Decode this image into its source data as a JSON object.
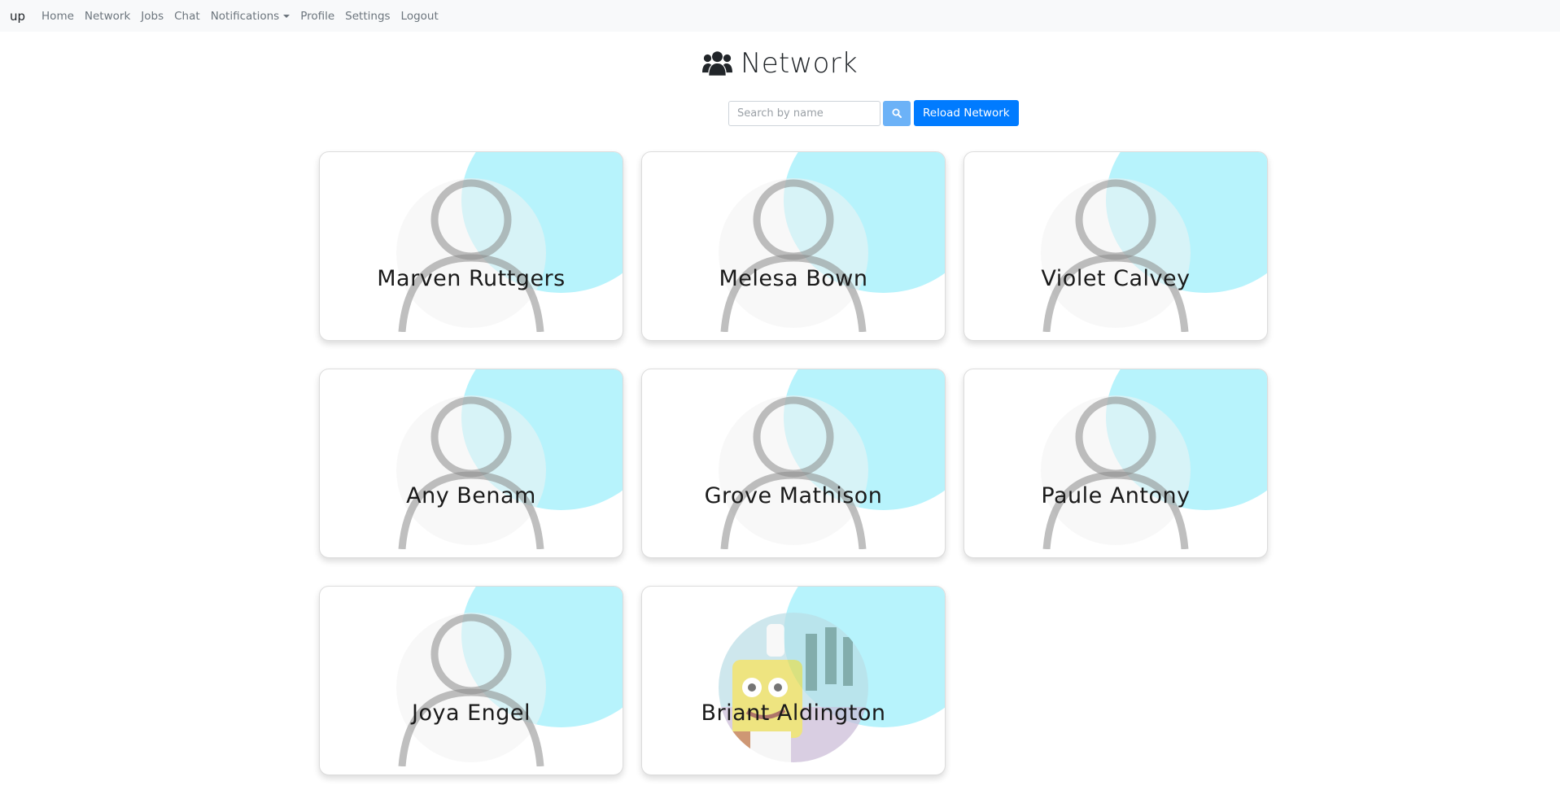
{
  "navbar": {
    "brand": "up",
    "links": [
      "Home",
      "Network",
      "Jobs",
      "Chat",
      "Notifications",
      "Profile",
      "Settings",
      "Logout"
    ]
  },
  "page": {
    "title": "Network",
    "title_icon": "users-icon"
  },
  "search": {
    "placeholder": "Search by name",
    "value": "",
    "button_icon": "search-icon",
    "reload_label": "Reload Network"
  },
  "cards": [
    {
      "name": "Marven Ruttgers",
      "avatar": "default-user-icon"
    },
    {
      "name": "Melesa Bown",
      "avatar": "default-user-icon"
    },
    {
      "name": "Violet Calvey",
      "avatar": "default-user-icon"
    },
    {
      "name": "Any Benam",
      "avatar": "default-user-icon"
    },
    {
      "name": "Grove Mathison",
      "avatar": "default-user-icon"
    },
    {
      "name": "Paule Antony",
      "avatar": "default-user-icon"
    },
    {
      "name": "Joya Engel",
      "avatar": "default-user-icon"
    },
    {
      "name": "Briant Aldington",
      "avatar": "cartoon-photo"
    }
  ],
  "colors": {
    "accent_blob": "#b7f3fc",
    "primary_button": "#007bff",
    "search_button": "#6cb2f7",
    "navbar_bg": "#f8f9fa"
  }
}
